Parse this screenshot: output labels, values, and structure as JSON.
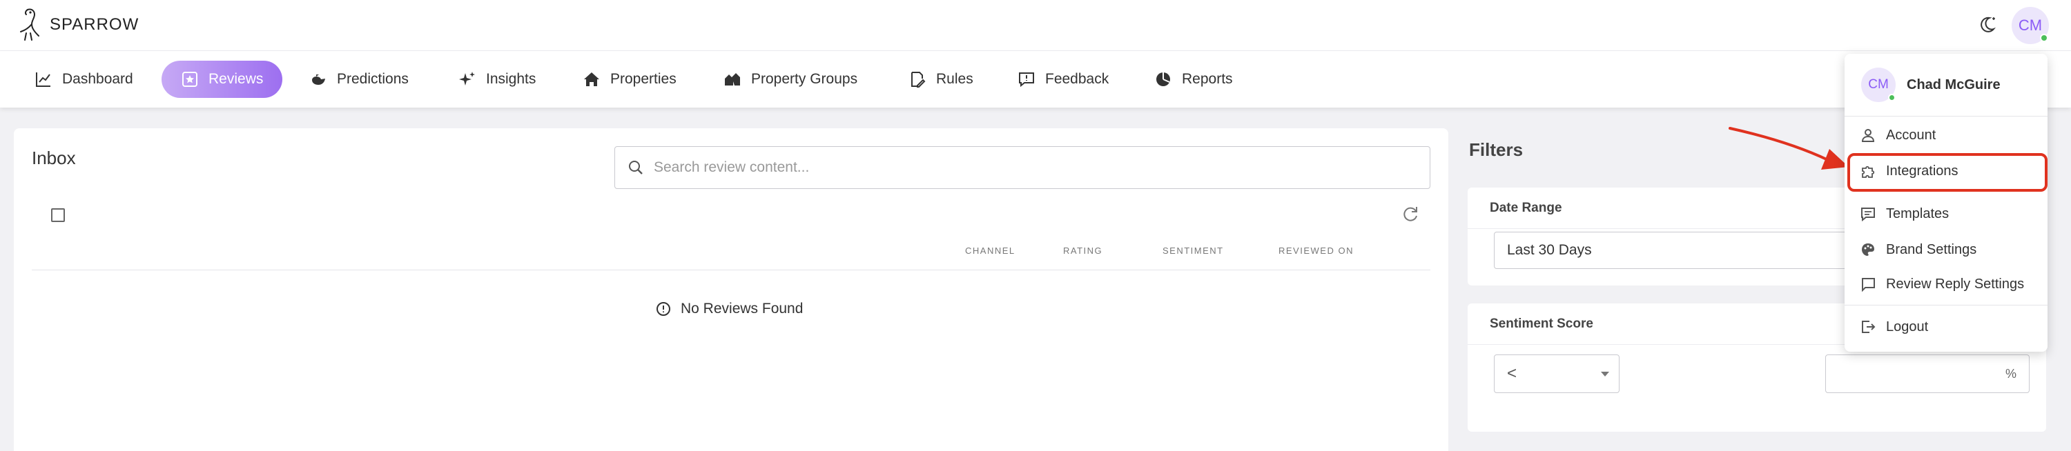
{
  "app": {
    "name": "SPARROW"
  },
  "header": {
    "avatar_initials": "CM"
  },
  "nav": {
    "items": [
      {
        "label": "Dashboard"
      },
      {
        "label": "Reviews"
      },
      {
        "label": "Predictions"
      },
      {
        "label": "Insights"
      },
      {
        "label": "Properties"
      },
      {
        "label": "Property Groups"
      },
      {
        "label": "Rules"
      },
      {
        "label": "Feedback"
      },
      {
        "label": "Reports"
      }
    ],
    "active": "Reviews"
  },
  "inbox": {
    "title": "Inbox",
    "search_placeholder": "Search review content...",
    "columns": [
      "CHANNEL",
      "RATING",
      "SENTIMENT",
      "REVIEWED ON"
    ],
    "empty_message": "No Reviews Found"
  },
  "filters": {
    "title": "Filters",
    "date_range": {
      "label": "Date Range",
      "value": "Last 30 Days"
    },
    "sentiment": {
      "label": "Sentiment Score",
      "operator": "<",
      "value": "",
      "unit": "%"
    }
  },
  "user_menu": {
    "initials": "CM",
    "name": "Chad McGuire",
    "items": [
      {
        "label": "Account",
        "icon": "person-icon"
      },
      {
        "label": "Integrations",
        "icon": "puzzle-icon"
      },
      {
        "label": "Templates",
        "icon": "message-icon"
      },
      {
        "label": "Brand Settings",
        "icon": "palette-icon"
      },
      {
        "label": "Review Reply Settings",
        "icon": "comment-icon"
      },
      {
        "label": "Logout",
        "icon": "logout-icon"
      }
    ],
    "highlighted": "Integrations"
  },
  "colors": {
    "accent": "#9d6ff0",
    "accent_light": "#c6a9f5",
    "annotation": "#e0321f",
    "online": "#4cbf5a"
  }
}
